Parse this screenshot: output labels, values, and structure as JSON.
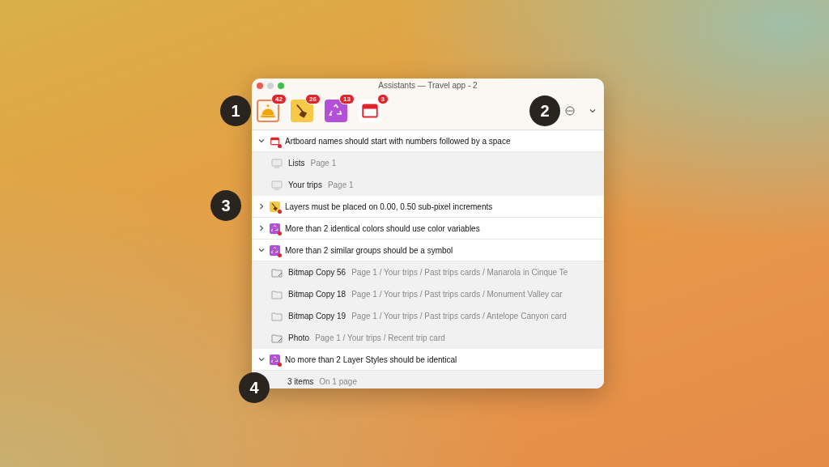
{
  "window": {
    "title": "Assistants — Travel app - 2"
  },
  "assistants": [
    {
      "kind": "bell",
      "count": "42",
      "selected": true
    },
    {
      "kind": "broom",
      "count": "26",
      "selected": false
    },
    {
      "kind": "recycle",
      "count": "13",
      "selected": false
    },
    {
      "kind": "calendar",
      "count": "3",
      "selected": false
    }
  ],
  "callouts": [
    {
      "label": "1"
    },
    {
      "label": "2"
    },
    {
      "label": "3"
    },
    {
      "label": "4"
    }
  ],
  "groups": [
    {
      "kind": "calendar",
      "title": "Artboard names should start with numbers followed by a space",
      "expanded": true,
      "children": [
        {
          "kind": "monitor",
          "name": "Lists",
          "path": "Page 1"
        },
        {
          "kind": "monitor",
          "name": "Your trips",
          "path": "Page 1"
        }
      ]
    },
    {
      "kind": "broom",
      "title": "Layers must be placed on 0.00, 0.50 sub-pixel increments",
      "expanded": false
    },
    {
      "kind": "recycle",
      "title": "More than 2 identical colors should use color variables",
      "expanded": false
    },
    {
      "kind": "recycle",
      "title": "More than 2 similar groups should be a symbol",
      "expanded": true,
      "children": [
        {
          "kind": "folder-edit",
          "name": "Bitmap Copy 56",
          "path": "Page 1 / Your trips / Past trips cards / Manarola in Cinque Te"
        },
        {
          "kind": "folder",
          "name": "Bitmap Copy 18",
          "path": "Page 1 / Your trips / Past trips cards / Monument Valley car"
        },
        {
          "kind": "folder",
          "name": "Bitmap Copy 19",
          "path": "Page 1 / Your trips / Past trips cards / Antelope Canyon card"
        },
        {
          "kind": "folder-edit",
          "name": "Photo",
          "path": "Page 1 / Your trips / Recent trip card"
        }
      ]
    },
    {
      "kind": "recycle",
      "title": "No more than 2 Layer Styles should be identical",
      "expanded": true,
      "children": [
        {
          "kind": "none",
          "name": "3 items",
          "path": "On 1 page"
        }
      ]
    }
  ]
}
